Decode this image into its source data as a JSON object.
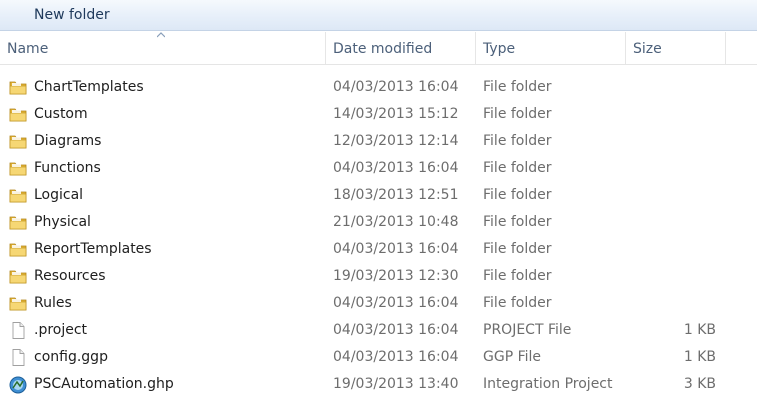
{
  "toolbar": {
    "new_folder_label": "New folder"
  },
  "columns": {
    "name": "Name",
    "date": "Date modified",
    "type": "Type",
    "size": "Size"
  },
  "rows": [
    {
      "name": "ChartTemplates",
      "date": "04/03/2013 16:04",
      "type": "File folder",
      "size": "",
      "icon": "folder-icon"
    },
    {
      "name": "Custom",
      "date": "14/03/2013 15:12",
      "type": "File folder",
      "size": "",
      "icon": "folder-icon"
    },
    {
      "name": "Diagrams",
      "date": "12/03/2013 12:14",
      "type": "File folder",
      "size": "",
      "icon": "folder-icon"
    },
    {
      "name": "Functions",
      "date": "04/03/2013 16:04",
      "type": "File folder",
      "size": "",
      "icon": "folder-icon"
    },
    {
      "name": "Logical",
      "date": "18/03/2013 12:51",
      "type": "File folder",
      "size": "",
      "icon": "folder-icon"
    },
    {
      "name": "Physical",
      "date": "21/03/2013 10:48",
      "type": "File folder",
      "size": "",
      "icon": "folder-icon"
    },
    {
      "name": "ReportTemplates",
      "date": "04/03/2013 16:04",
      "type": "File folder",
      "size": "",
      "icon": "folder-icon"
    },
    {
      "name": "Resources",
      "date": "19/03/2013 12:30",
      "type": "File folder",
      "size": "",
      "icon": "folder-icon"
    },
    {
      "name": "Rules",
      "date": "04/03/2013 16:04",
      "type": "File folder",
      "size": "",
      "icon": "folder-icon"
    },
    {
      "name": ".project",
      "date": "04/03/2013 16:04",
      "type": "PROJECT File",
      "size": "1 KB",
      "icon": "file-icon"
    },
    {
      "name": "config.ggp",
      "date": "04/03/2013 16:04",
      "type": "GGP File",
      "size": "1 KB",
      "icon": "file-icon"
    },
    {
      "name": "PSCAutomation.ghp",
      "date": "19/03/2013 13:40",
      "type": "Integration Project",
      "size": "3 KB",
      "icon": "integration-project-icon"
    }
  ]
}
